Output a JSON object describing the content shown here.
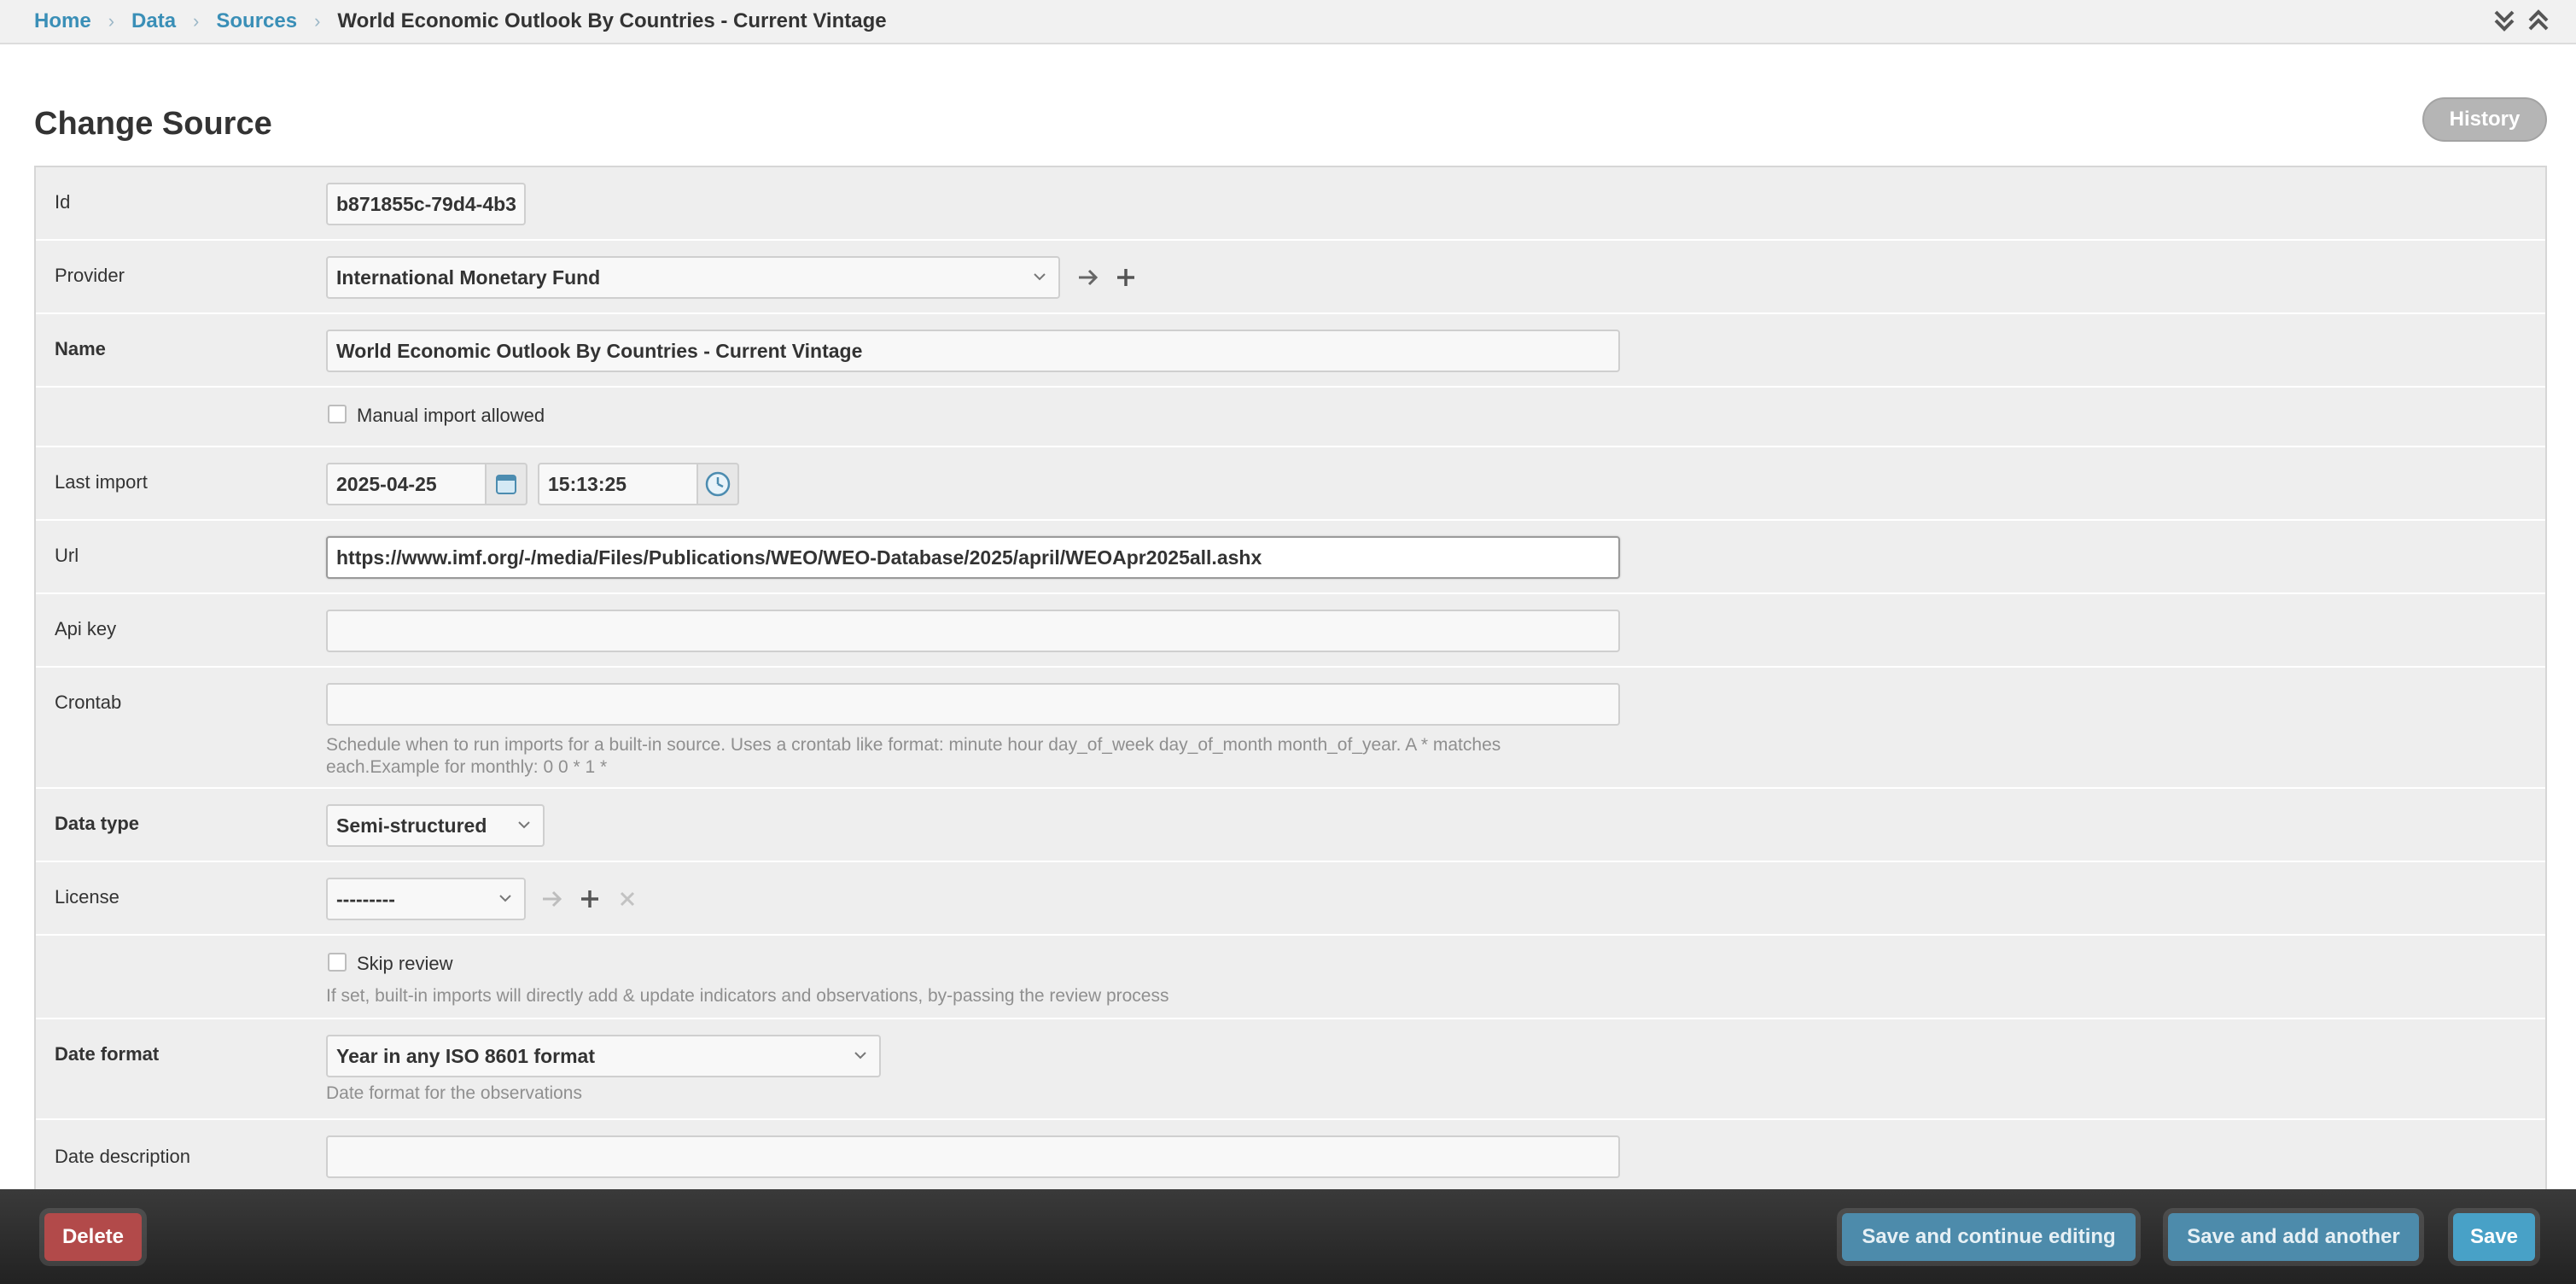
{
  "breadcrumbs": {
    "home": "Home",
    "data": "Data",
    "sources": "Sources",
    "current": "World Economic Outlook By Countries - Current Vintage"
  },
  "page": {
    "title": "Change Source",
    "history_label": "History"
  },
  "fields": {
    "id": {
      "label": "Id",
      "value": "b871855c-79d4-4b3"
    },
    "provider": {
      "label": "Provider",
      "value": "International Monetary Fund"
    },
    "name": {
      "label": "Name",
      "value": "World Economic Outlook By Countries - Current Vintage"
    },
    "manual_import": {
      "label": "Manual import allowed",
      "checked": false
    },
    "last_import": {
      "label": "Last import",
      "date": "2025-04-25",
      "time": "15:13:25"
    },
    "url": {
      "label": "Url",
      "value": "https://www.imf.org/-/media/Files/Publications/WEO/WEO-Database/2025/april/WEOApr2025all.ashx"
    },
    "api_key": {
      "label": "Api key",
      "value": ""
    },
    "crontab": {
      "label": "Crontab",
      "value": "",
      "help_line1": "Schedule when to run imports for a built-in source. Uses a crontab like format: minute hour day_of_week day_of_month month_of_year. A * matches",
      "help_line2": "each.Example for monthly: 0 0 * 1 *"
    },
    "data_type": {
      "label": "Data type",
      "value": "Semi-structured"
    },
    "license": {
      "label": "License",
      "value": "---------"
    },
    "skip_review": {
      "label": "Skip review",
      "checked": false,
      "help": "If set, built-in imports will directly add & update indicators and observations, by-passing the review process"
    },
    "date_format": {
      "label": "Date format",
      "value": "Year in any ISO 8601 format",
      "help": "Date format for the observations"
    },
    "date_description": {
      "label": "Date description",
      "value": ""
    }
  },
  "footer": {
    "delete_label": "Delete",
    "continue_label": "Save and continue editing",
    "another_label": "Save and add another",
    "save_label": "Save"
  },
  "colors": {
    "link": "#3a8fb7",
    "delete": "#b24a4a",
    "save": "#48a1c7",
    "secondary_save": "#4d8bab"
  }
}
